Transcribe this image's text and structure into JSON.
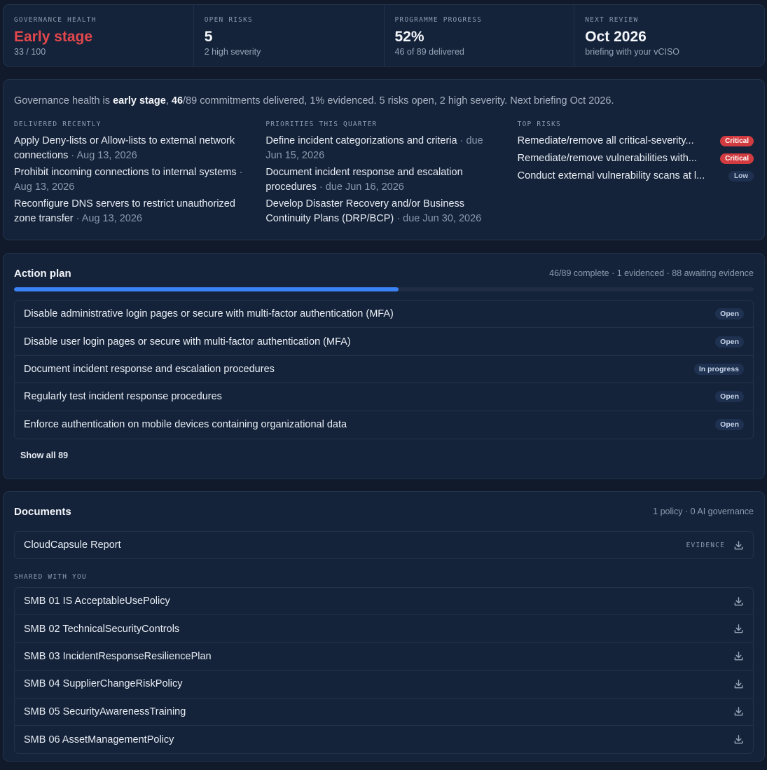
{
  "stats": [
    {
      "label": "GOVERNANCE HEALTH",
      "value": "Early stage",
      "sub": "33 / 100"
    },
    {
      "label": "OPEN RISKS",
      "value": "5",
      "sub": "2 high severity"
    },
    {
      "label": "PROGRAMME PROGRESS",
      "value": "52%",
      "sub": "46 of 89 delivered"
    },
    {
      "label": "NEXT REVIEW",
      "value": "Oct 2026",
      "sub": "briefing with your vCISO"
    }
  ],
  "summary": {
    "p1": "Governance health is ",
    "b1": "early stage",
    "p2": ", ",
    "b2": "46",
    "p3": "/89 commitments delivered, 1% evidenced. 5 risks open, 2 high severity. Next briefing Oct 2026."
  },
  "delivered": {
    "label": "DELIVERED RECENTLY",
    "items": [
      {
        "title": "Apply Deny-lists or Allow-lists to external network connections",
        "date": " · Aug 13, 2026"
      },
      {
        "title": "Prohibit incoming connections to internal systems",
        "date": " · Aug 13, 2026"
      },
      {
        "title": "Reconfigure DNS servers to restrict unauthorized zone transfer",
        "date": " · Aug 13, 2026"
      }
    ]
  },
  "priorities": {
    "label": "PRIORITIES THIS QUARTER",
    "items": [
      {
        "title": "Define incident categorizations and criteria",
        "date": " · due Jun 15, 2026"
      },
      {
        "title": "Document incident response and escalation procedures",
        "date": " · due Jun 16, 2026"
      },
      {
        "title": "Develop Disaster Recovery and/or Business Continuity Plans (DRP/BCP)",
        "date": " · due Jun 30, 2026"
      }
    ]
  },
  "risks": {
    "label": "TOP RISKS",
    "items": [
      {
        "title": "Remediate/remove all critical-severity...",
        "severity": "Critical"
      },
      {
        "title": "Remediate/remove vulnerabilities with...",
        "severity": "Critical"
      },
      {
        "title": "Conduct external vulnerability scans at l...",
        "severity": "Low"
      }
    ]
  },
  "action_plan": {
    "title": "Action plan",
    "meta": "46/89 complete · 1 evidenced · 88 awaiting evidence",
    "progress": 0.52,
    "items": [
      {
        "title": "Disable administrative login pages or secure with multi-factor authentication (MFA)",
        "status": "Open"
      },
      {
        "title": "Disable user login pages or secure with multi-factor authentication (MFA)",
        "status": "Open"
      },
      {
        "title": "Document incident response and escalation procedures",
        "status": "In progress"
      },
      {
        "title": "Regularly test incident response procedures",
        "status": "Open"
      },
      {
        "title": "Enforce authentication on mobile devices containing organizational data",
        "status": "Open"
      }
    ],
    "show_all": "Show all 89"
  },
  "documents": {
    "title": "Documents",
    "meta": "1 policy · 0 AI governance",
    "main": {
      "name": "CloudCapsule Report",
      "tag": "EVIDENCE"
    },
    "shared_label": "SHARED WITH YOU",
    "shared": [
      "SMB 01 IS AcceptableUsePolicy",
      "SMB 02 TechnicalSecurityControls",
      "SMB 03 IncidentResponseResiliencePlan",
      "SMB 04 SupplierChangeRiskPolicy",
      "SMB 05 SecurityAwarenessTraining",
      "SMB 06 AssetManagementPolicy"
    ]
  },
  "colors": {
    "accent": "#3b82f6",
    "critical": "#d23b3f",
    "early_stage": "#e2474c"
  }
}
